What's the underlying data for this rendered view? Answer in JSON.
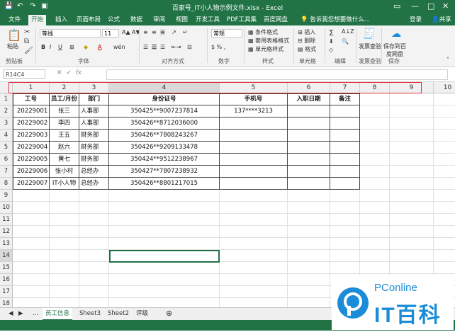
{
  "window": {
    "title": "百家号_IT小人物示例文件.xlsx - Excel",
    "login": "登录",
    "share": "共享"
  },
  "menu": {
    "tabs": [
      "文件",
      "开始",
      "插入",
      "页面布局",
      "公式",
      "数据",
      "审阅",
      "视图",
      "开发工具",
      "PDF工具集",
      "百度网盘"
    ],
    "active_index": 1,
    "tell_me": "告诉我您想要做什么..."
  },
  "ribbon": {
    "paste_label": "粘贴",
    "clipboard_label": "剪贴板",
    "font_name": "等线",
    "font_size": "11",
    "font_label": "字体",
    "align_label": "对齐方式",
    "number_format": "常规",
    "number_label": "数字",
    "cond_format": "条件格式",
    "table_format": "套用表格格式",
    "cell_style": "单元格样式",
    "styles_label": "样式",
    "insert": "插入",
    "delete": "删除",
    "format": "格式",
    "cells_label": "单元格",
    "editing_label": "编辑",
    "invoice_check": "发票查验",
    "invoice_label": "发票查验",
    "save_baidu": "保存到百度网盘",
    "save_label": "保存"
  },
  "formula_bar": {
    "name_box": "R14C4",
    "fx": "fx",
    "value": ""
  },
  "grid": {
    "col_headers": [
      "1",
      "2",
      "3",
      "4",
      "5",
      "6",
      "7",
      "8",
      "9",
      "10"
    ],
    "row_headers": [
      "1",
      "2",
      "3",
      "4",
      "5",
      "6",
      "7",
      "8",
      "9",
      "10",
      "11",
      "12",
      "13",
      "14",
      "15",
      "16",
      "17",
      "18"
    ],
    "table_headers": [
      "工号",
      "员工/月份",
      "部门",
      "身份证号",
      "手机号",
      "入职日期",
      "备注"
    ],
    "rows": [
      [
        "20229001",
        "张三",
        "人事部",
        "350425**9007237814",
        "137****3213",
        "",
        ""
      ],
      [
        "20229002",
        "李四",
        "人事部",
        "350426**8712036000",
        "",
        "",
        ""
      ],
      [
        "20229003",
        "王五",
        "财务部",
        "350426**7808243267",
        "",
        "",
        ""
      ],
      [
        "20229004",
        "赵六",
        "财务部",
        "350426**9209133478",
        "",
        "",
        ""
      ],
      [
        "20229005",
        "黄七",
        "财务部",
        "350424**9512238967",
        "",
        "",
        ""
      ],
      [
        "20229006",
        "张小村",
        "总经办",
        "350427**7807238932",
        "",
        "",
        ""
      ],
      [
        "20229007",
        "IT小人物",
        "总经办",
        "350426**8801217015",
        "",
        "",
        ""
      ]
    ]
  },
  "sheet_tabs": [
    "员工信息",
    "Sheet3",
    "Sheet2",
    "评级"
  ],
  "active_sheet": 0,
  "watermark": {
    "brand": "PConline",
    "name": "IT百科"
  },
  "colors": {
    "excel_green": "#217346",
    "highlight_red": "#e0303a",
    "watermark_blue": "#1a8cd8"
  }
}
